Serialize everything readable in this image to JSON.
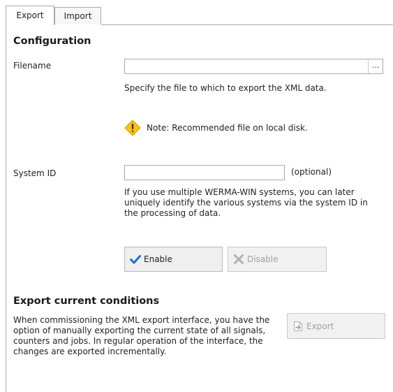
{
  "tabs": [
    {
      "label": "Export",
      "active": true
    },
    {
      "label": "Import",
      "active": false
    }
  ],
  "configuration": {
    "title": "Configuration",
    "filename_label": "Filename",
    "filename_value": "",
    "browse_label": "...",
    "filename_help": "Specify the file to which to export the XML data.",
    "note_icon": "warning-icon",
    "note_text": "Note: Recommended file on local disk.",
    "system_id_label": "System ID",
    "system_id_value": "",
    "optional_label": "(optional)",
    "system_id_help_lines": [
      "If you use multiple WERMA-WIN systems, you can later",
      "uniquely identify the various systems via the system ID in",
      "the processing of data."
    ],
    "enable_label": "Enable",
    "disable_label": "Disable"
  },
  "export_current": {
    "title": "Export current conditions",
    "description_lines": [
      "When commissioning the XML export interface, you have the",
      "option of manually exporting the current state of all signals,",
      "counters and jobs. In regular operation of the interface, the",
      "changes are exported incrementally."
    ],
    "export_label": "Export"
  },
  "colors": {
    "accent_check": "#1e6fd9",
    "warning_fill": "#f7c21b",
    "disabled_text": "#a0a0a0",
    "border": "#a9a9a9"
  }
}
